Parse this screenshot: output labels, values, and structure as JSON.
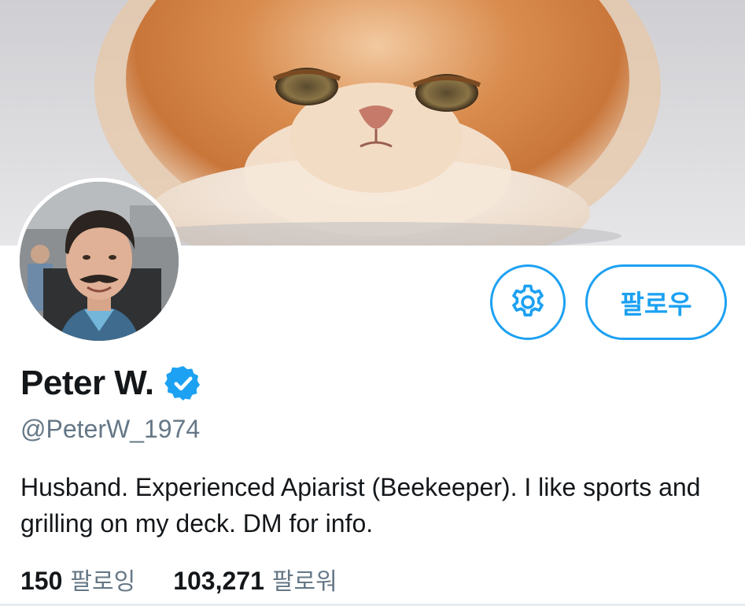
{
  "banner": {
    "image": "persian-cat-banner"
  },
  "profile": {
    "avatar": "profile-photo",
    "display_name": "Peter W.",
    "verified_icon": "verified-badge-icon",
    "handle": "@PeterW_1974",
    "bio": "Husband. Experienced Apiarist (Beekeeper). I like sports and grilling on my deck. DM for info."
  },
  "actions": {
    "settings_icon": "gear-icon",
    "follow_label": "팔로우"
  },
  "stats": {
    "following_count": "150",
    "following_label": "팔로잉",
    "followers_count": "103,271",
    "followers_label": "팔로워"
  },
  "colors": {
    "accent": "#1da1f2",
    "text_primary": "#14171a",
    "text_secondary": "#657786"
  }
}
